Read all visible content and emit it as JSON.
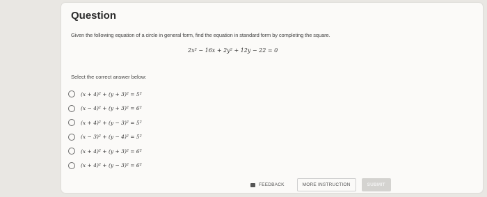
{
  "question": {
    "title": "Question",
    "text": "Given the following equation of a circle in general form, find the equation in standard form by completing the square.",
    "equation": "2x² − 16x + 2y² + 12y − 22 = 0",
    "prompt": "Select the correct answer below:"
  },
  "options": [
    "(x + 4)² + (y + 3)² = 5²",
    "(x − 4)² + (y + 3)² = 6²",
    "(x + 4)² + (y − 3)² = 5²",
    "(x − 3)² + (y − 4)² = 5²",
    "(x + 4)² + (y + 3)² = 6²",
    "(x + 4)² + (y − 3)² = 6²"
  ],
  "footer": {
    "feedback_label": "FEEDBACK",
    "more_instruction_label": "MORE INSTRUCTION",
    "submit_label": "SUBMIT"
  }
}
